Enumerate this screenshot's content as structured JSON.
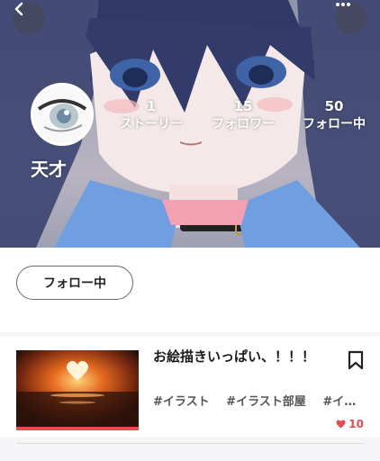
{
  "header": {
    "back_icon": "chevron-left-icon",
    "more_icon": "more-horizontal-icon"
  },
  "profile": {
    "username": "天才",
    "stats": [
      {
        "value": "1",
        "label": "ストーリー"
      },
      {
        "value": "15",
        "label": "フォロワー"
      },
      {
        "value": "50",
        "label": "フォロー中"
      }
    ],
    "follow_button_label": "フォロー中"
  },
  "story": {
    "title": "お絵描きいっぱい、！！！",
    "tags": [
      "#イラスト",
      "#イラスト部屋",
      "#イ…"
    ],
    "likes": "10",
    "bookmark_icon": "bookmark-icon"
  },
  "colors": {
    "accent": "#e94b52"
  }
}
